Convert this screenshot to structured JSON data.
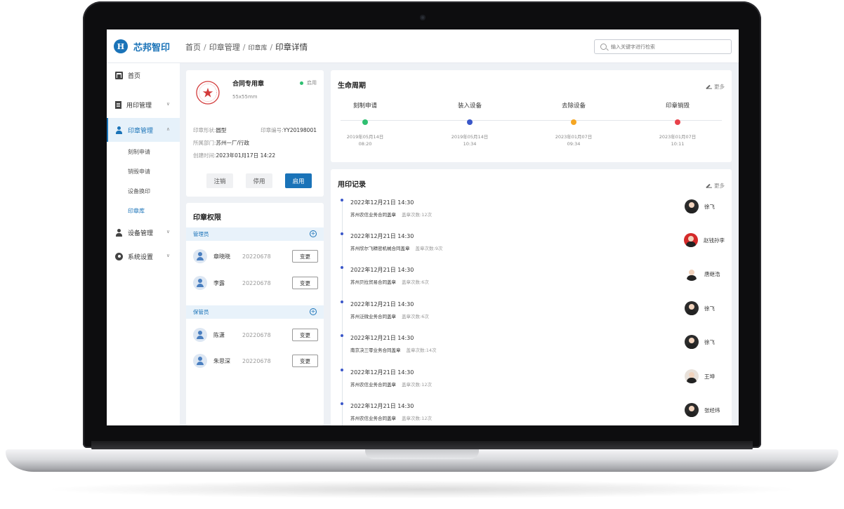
{
  "app": {
    "logo_mark": "H",
    "logo_text": "芯邦智印"
  },
  "breadcrumb": {
    "items": [
      "首页",
      "印章管理",
      "印章库"
    ],
    "current": "印章详情",
    "separator": "/"
  },
  "search": {
    "placeholder": "输入关键字进行检索"
  },
  "sidebar": {
    "items": [
      {
        "label": "首页",
        "icon": "home-icon"
      },
      {
        "label": "用印管理",
        "icon": "document-icon"
      },
      {
        "label": "印章管理",
        "icon": "user-icon"
      },
      {
        "label": "设备管理",
        "icon": "user-icon"
      },
      {
        "label": "系统设置",
        "icon": "gear-icon"
      }
    ],
    "sub_items": [
      "刻制申请",
      "销毁申请",
      "设备换印",
      "印章库"
    ],
    "active": "印章管理",
    "active_sub": "印章库"
  },
  "seal": {
    "name": "合同专用章",
    "size": "55x55mm",
    "status": "启用",
    "shape_label": "印章形状:",
    "shape": "圆型",
    "code_label": "印章编号:",
    "code": "YY20198001",
    "dept_label": "所属部门:",
    "dept": "苏州一厂/行政",
    "created_label": "创建时间:",
    "created": "2023年01月17日 14:22",
    "buttons": {
      "cancel": "注销",
      "disable": "停用",
      "enable": "启用"
    }
  },
  "permissions": {
    "title": "印章权限",
    "change_label": "变更",
    "groups": [
      {
        "role": "管理员",
        "members": [
          {
            "name": "章晓晓",
            "id": "20220678"
          },
          {
            "name": "李露",
            "id": "20220678"
          }
        ]
      },
      {
        "role": "保管员",
        "members": [
          {
            "name": "陈潇",
            "id": "20220678"
          },
          {
            "name": "朱思深",
            "id": "20220678"
          }
        ]
      }
    ]
  },
  "lifecycle": {
    "title": "生命周期",
    "more": "更多",
    "stages": [
      {
        "label": "刻制申请",
        "date": "2019年05月14日",
        "time": "08:20",
        "color": "#2fbf71"
      },
      {
        "label": "装入设备",
        "date": "2019年05月14日",
        "time": "10:34",
        "color": "#3a57c9"
      },
      {
        "label": "去除设备",
        "date": "2023年01月07日",
        "time": "09:34",
        "color": "#f5a623"
      },
      {
        "label": "印章销毁",
        "date": "2023年01月07日",
        "time": "10:11",
        "color": "#e8414a"
      }
    ]
  },
  "records": {
    "title": "用印记录",
    "more": "更多",
    "count_label": "盖章次数:",
    "items": [
      {
        "datetime": "2022年12月21日 14:30",
        "doc": "苏州农信业务合同盖章",
        "count": "12次",
        "user": "徐飞"
      },
      {
        "datetime": "2022年12月21日 14:30",
        "doc": "苏州欣尔飞精密机械合同盖章",
        "count": "9次",
        "user": "赵钱孙李"
      },
      {
        "datetime": "2022年12月21日 14:30",
        "doc": "苏州贝拉贸易合同盖章",
        "count": "6次",
        "user": "唐继浩"
      },
      {
        "datetime": "2022年12月21日 14:30",
        "doc": "苏州泛微业务合同盖章",
        "count": "6次",
        "user": "徐飞"
      },
      {
        "datetime": "2022年12月21日 14:30",
        "doc": "南京决三零业务合同盖章",
        "count": "14次",
        "user": "徐飞"
      },
      {
        "datetime": "2022年12月21日 14:30",
        "doc": "苏州农信业务合同盖章",
        "count": "12次",
        "user": "王坤"
      },
      {
        "datetime": "2022年12月21日 14:30",
        "doc": "苏州农信业务合同盖章",
        "count": "12次",
        "user": "张经纬"
      }
    ]
  },
  "colors": {
    "accent": "#1a73b8",
    "active_green": "#2fbf71",
    "timeline_dot": "#3a57c9"
  }
}
